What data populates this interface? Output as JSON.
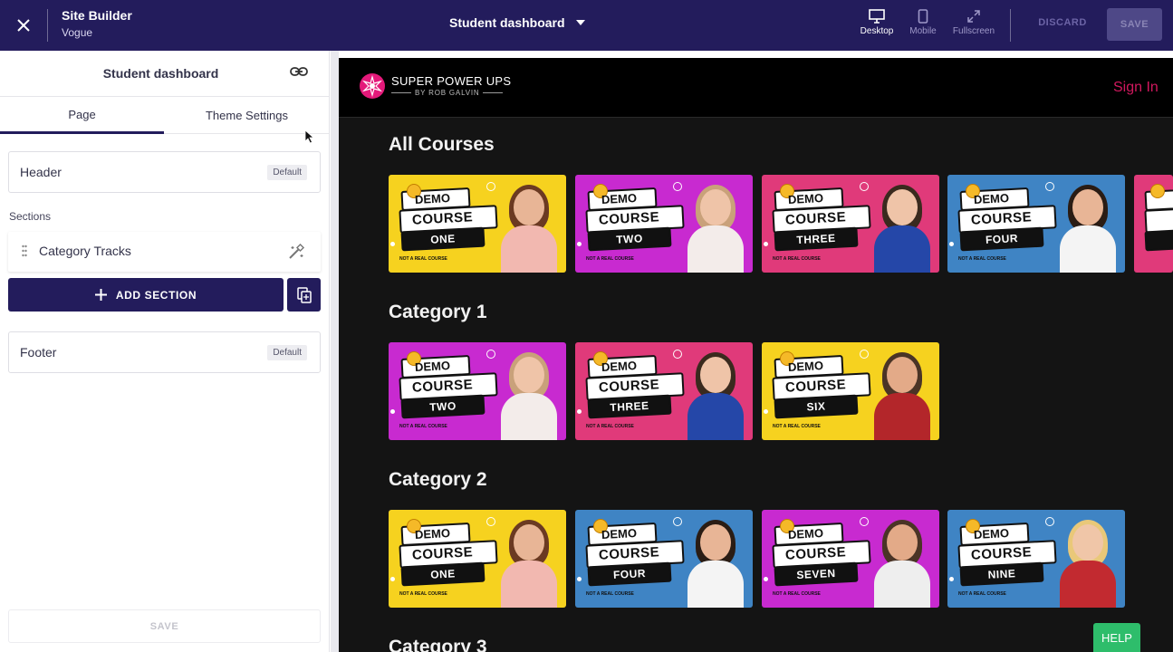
{
  "topbar": {
    "app_title": "Site Builder",
    "app_subtitle": "Vogue",
    "page_selector": "Student dashboard",
    "views": [
      {
        "label": "Desktop",
        "icon": "desktop-icon"
      },
      {
        "label": "Mobile",
        "icon": "mobile-icon"
      },
      {
        "label": "Fullscreen",
        "icon": "fullscreen-icon"
      }
    ],
    "discard_label": "DISCARD",
    "save_label": "SAVE"
  },
  "sidebar": {
    "title": "Student dashboard",
    "tabs": [
      {
        "label": "Page",
        "active": true
      },
      {
        "label": "Theme Settings",
        "active": false
      }
    ],
    "header_row": {
      "label": "Header",
      "badge": "Default"
    },
    "sections_label": "Sections",
    "sections": [
      {
        "label": "Category Tracks"
      }
    ],
    "add_section_label": "ADD SECTION",
    "footer_row": {
      "label": "Footer",
      "badge": "Default"
    },
    "save_label": "SAVE"
  },
  "preview": {
    "brand_name": "SUPER POWER UPS",
    "brand_tagline": "BY ROB GALVIN",
    "sign_in": "Sign In",
    "card_line1": "DEMO",
    "card_line2": "COURSE",
    "card_note": "NOT A REAL COURSE",
    "categories": [
      {
        "title": "All Courses",
        "courses": [
          "ONE",
          "TWO",
          "THREE",
          "FOUR",
          ""
        ]
      },
      {
        "title": "Category 1",
        "courses": [
          "TWO",
          "THREE",
          "SIX"
        ]
      },
      {
        "title": "Category 2",
        "courses": [
          "ONE",
          "FOUR",
          "SEVEN",
          "NINE"
        ]
      },
      {
        "title": "Category 3",
        "courses": []
      }
    ]
  },
  "help_label": "HELP",
  "colors": {
    "topbar_bg": "#231c5c",
    "accent_pink": "#d1185e",
    "help_green": "#2ebd6b",
    "card_yellow": "#f6d21f",
    "card_magenta": "#c82ad0",
    "card_pink": "#e03a7a",
    "card_blue": "#3f84c4"
  }
}
